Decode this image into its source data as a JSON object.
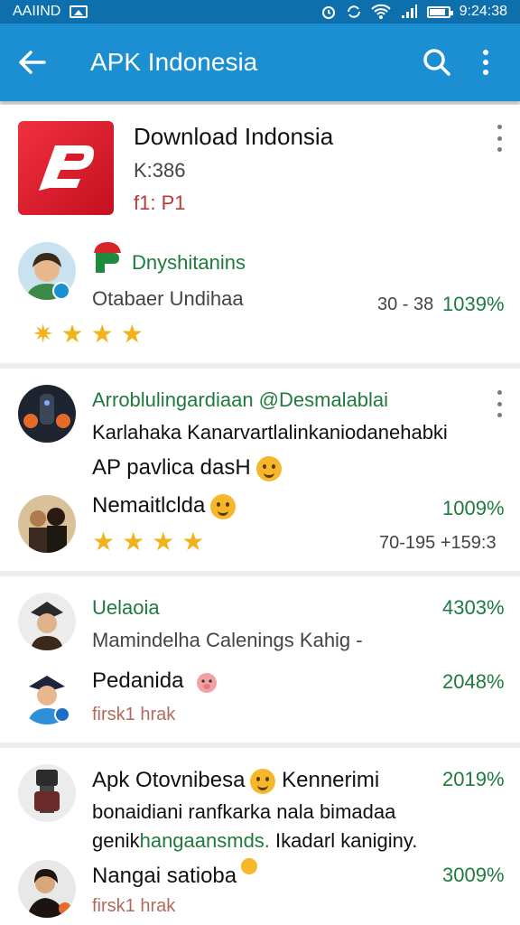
{
  "status_bar": {
    "carrier": "AAIIND",
    "time": "9:24:38",
    "icons": [
      "image-icon",
      "alarm-icon",
      "sync-icon",
      "wifi-icon",
      "signal-icon",
      "battery-icon"
    ]
  },
  "app_bar": {
    "title": "APK Indonesia",
    "icons": [
      "back-arrow-icon",
      "search-icon",
      "overflow-menu-icon"
    ],
    "color": "#1b8fd1"
  },
  "app_card": {
    "title": "Download Indonsia",
    "subtitle": "K:386",
    "price": "f1: P1",
    "icon": "app-logo-icon",
    "accent": "#d81b2a"
  },
  "review_1": {
    "author": "Dnyshitanins",
    "text": "Otabaer Undihaa",
    "meta": "30 - 38",
    "percent": "1039%",
    "rating": 3
  },
  "post_2": {
    "handle": "Arroblulingardiaan @Desmalablai",
    "line1": "Karlahaka Kanarvartlalinkaniodanehabki",
    "line2": "AP pavlica dasH",
    "name": "Nemaitlclda",
    "percent": "1009%",
    "meta": "70-195 +159:3",
    "rating": 4
  },
  "post_3": {
    "name": "Uelaoia",
    "percent": "4303%",
    "line": "Mamindelha Calenings Kahig -",
    "name2": "Pedanida",
    "percent2": "2048%",
    "sub": "firsk1 hrak"
  },
  "post_4": {
    "line1": "Apk Otovnibesa",
    "line1b": "Kennerimi",
    "percent": "2019%",
    "line2": "bonaidiani ranfkarka nala bimadaa",
    "line3a": "genik",
    "line3b": "hangaansmds.",
    "line3c": "Ikadarl kaniginy.",
    "name": "Nangai satioba",
    "percent2": "3009%",
    "sub": "firsk1 hrak"
  }
}
